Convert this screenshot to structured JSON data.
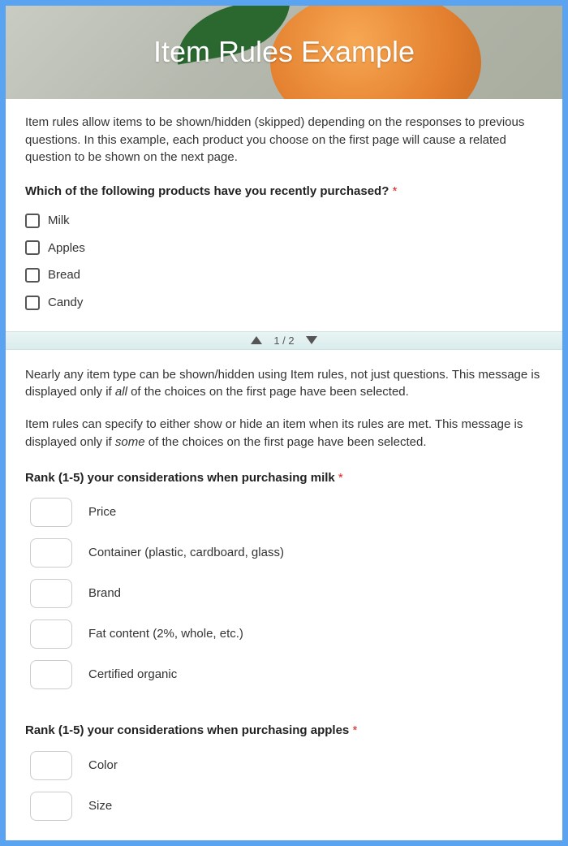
{
  "header": {
    "title": "Item Rules Example"
  },
  "page1": {
    "intro": "Item rules allow items to be shown/hidden (skipped) depending on the responses to previous questions. In this example, each product you choose on the first page will cause a related question to be shown on the next page.",
    "question1": {
      "prompt": "Which of the following products have you recently purchased?",
      "required_mark": "*",
      "options": [
        "Milk",
        "Apples",
        "Bread",
        "Candy"
      ]
    }
  },
  "nav": {
    "label": "1 / 2"
  },
  "page2": {
    "msg_all_pre": "Nearly any item type can be shown/hidden using Item rules, not just questions. This message is displayed only if ",
    "msg_all_em": "all",
    "msg_all_post": " of the choices on the first page have been selected.",
    "msg_some_pre": "Item rules can specify to either show or hide an item when its rules are met. This message is displayed only if ",
    "msg_some_em": "some",
    "msg_some_post": " of the choices on the first page have been selected.",
    "question_milk": {
      "prompt": "Rank (1-5) your considerations when purchasing milk",
      "required_mark": "*",
      "items": [
        "Price",
        "Container (plastic, cardboard, glass)",
        "Brand",
        "Fat content (2%, whole, etc.)",
        "Certified organic"
      ]
    },
    "question_apples": {
      "prompt": "Rank (1-5) your considerations when purchasing apples",
      "required_mark": "*",
      "items": [
        "Color",
        "Size"
      ]
    }
  }
}
